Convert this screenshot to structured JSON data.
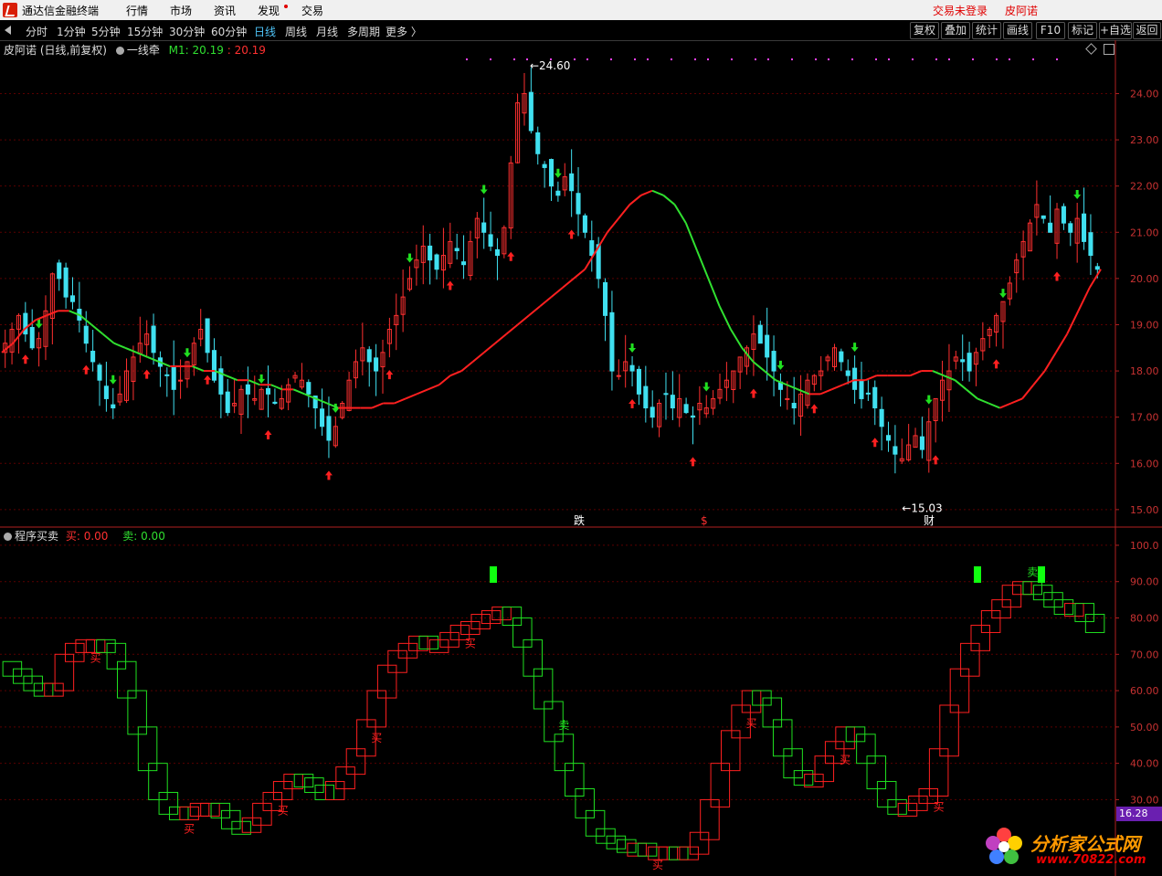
{
  "app": {
    "title": "通达信金融终端",
    "login_status": "交易未登录",
    "stock_name": "皮阿诺"
  },
  "menu": [
    "行情",
    "市场",
    "资讯",
    "发现",
    "交易"
  ],
  "periods": [
    "分时",
    "1分钟",
    "5分钟",
    "15分钟",
    "30分钟",
    "60分钟",
    "日线",
    "周线",
    "月线",
    "多周期",
    "更多 〉"
  ],
  "active_period": "日线",
  "right_buttons": [
    "复权",
    "叠加",
    "统计",
    "画线",
    "F10",
    "标记",
    "+自选",
    "返回"
  ],
  "main_panel": {
    "title": "皮阿诺 (日线,前复权)",
    "indicator": "一线牵",
    "m1_label": "M1:",
    "m1_value": "20.19",
    "m1_value2": ": 20.19",
    "high_label": "24.60",
    "low_label": "15.03",
    "markers": [
      "跌",
      "$",
      "财"
    ],
    "y_ticks": [
      "24.00",
      "23.00",
      "22.00",
      "21.00",
      "20.00",
      "19.00",
      "18.00",
      "17.00",
      "16.00",
      "15.00"
    ]
  },
  "sub_panel": {
    "title": "程序买卖",
    "buy_label": "买: 0.00",
    "sell_label": "卖: 0.00",
    "buy_text": "买",
    "sell_text": "卖",
    "y_ticks": [
      "100.0",
      "90.00",
      "80.00",
      "70.00",
      "60.00",
      "50.00",
      "40.00",
      "30.00"
    ],
    "current_value": "16.28"
  },
  "watermark": {
    "name": "分析家公式网",
    "url": "www.70822.com"
  },
  "colors": {
    "up": "#ff3030",
    "down": "#40e0f0",
    "ma_down": "#30e030",
    "ma_up": "#ff2020",
    "grid": "#5a0000"
  },
  "chart_data": {
    "type": "candlestick",
    "price_range": [
      14.8,
      24.8
    ],
    "close_series": [
      18.6,
      18.9,
      19.2,
      18.8,
      18.5,
      18.7,
      19.3,
      20.1,
      20.0,
      19.6,
      19.5,
      19.1,
      18.6,
      18.2,
      17.8,
      17.4,
      17.2,
      17.5,
      18.0,
      18.3,
      18.6,
      18.8,
      18.4,
      18.1,
      17.9,
      17.6,
      17.8,
      18.2,
      18.6,
      18.9,
      18.4,
      17.8,
      17.5,
      17.1,
      17.3,
      17.6,
      17.5,
      17.4,
      17.6,
      17.5,
      17.3,
      17.4,
      17.7,
      17.9,
      17.8,
      17.5,
      17.2,
      16.8,
      16.5,
      16.8,
      17.3,
      17.8,
      18.2,
      18.5,
      18.2,
      18.0,
      18.4,
      18.9,
      19.2,
      19.6,
      20.0,
      20.4,
      20.7,
      20.4,
      20.2,
      20.5,
      20.8,
      20.6,
      20.3,
      20.8,
      21.3,
      21.0,
      20.7,
      20.5,
      21.1,
      22.5,
      23.8,
      24.0,
      23.2,
      22.7,
      22.4,
      22.0,
      21.8,
      22.2,
      21.9,
      21.4,
      21.0,
      20.5,
      20.0,
      19.2,
      18.0,
      17.9,
      18.2,
      18.0,
      17.5,
      17.2,
      17.0,
      17.3,
      17.5,
      17.2,
      17.4,
      17.1,
      17.0,
      17.3,
      17.2,
      17.4,
      17.6,
      17.8,
      18.0,
      18.3,
      18.5,
      18.8,
      18.6,
      18.3,
      18.0,
      17.6,
      17.4,
      17.2,
      17.5,
      17.8,
      17.9,
      18.0,
      18.3,
      18.5,
      18.2,
      17.9,
      17.6,
      17.4,
      17.5,
      17.2,
      16.8,
      16.5,
      16.2,
      16.1,
      16.4,
      16.6,
      16.3,
      16.9,
      17.4,
      17.8,
      18.0,
      18.3,
      18.2,
      18.0,
      18.4,
      18.7,
      18.9,
      19.2,
      19.5,
      19.9,
      20.4,
      20.8,
      21.2,
      21.6,
      21.3,
      21.0,
      21.5,
      21.2,
      21.0,
      21.3,
      20.8,
      20.5,
      20.2
    ],
    "ma_series": [
      18.4,
      18.6,
      18.9,
      19.1,
      19.2,
      19.3,
      19.3,
      19.2,
      19.0,
      18.8,
      18.6,
      18.5,
      18.4,
      18.3,
      18.2,
      18.1,
      18.1,
      18.1,
      18.0,
      18.0,
      17.9,
      17.8,
      17.8,
      17.7,
      17.7,
      17.6,
      17.6,
      17.5,
      17.4,
      17.3,
      17.2,
      17.2,
      17.2,
      17.2,
      17.3,
      17.3,
      17.4,
      17.5,
      17.6,
      17.7,
      17.9,
      18.0,
      18.2,
      18.4,
      18.6,
      18.8,
      19.0,
      19.2,
      19.4,
      19.6,
      19.8,
      20.0,
      20.2,
      20.6,
      21.0,
      21.3,
      21.6,
      21.8,
      21.9,
      21.8,
      21.6,
      21.2,
      20.6,
      20.0,
      19.4,
      18.9,
      18.5,
      18.2,
      18.0,
      17.8,
      17.7,
      17.6,
      17.5,
      17.5,
      17.6,
      17.7,
      17.8,
      17.8,
      17.9,
      17.9,
      17.9,
      17.9,
      18.0,
      18.0,
      17.9,
      17.8,
      17.6,
      17.4,
      17.3,
      17.2,
      17.3,
      17.4,
      17.7,
      18.0,
      18.4,
      18.8,
      19.3,
      19.8,
      20.2
    ],
    "cci_series": [
      68,
      66,
      64,
      62,
      61,
      62,
      70,
      73,
      74,
      74,
      73,
      68,
      60,
      50,
      40,
      32,
      28,
      27,
      28,
      29,
      29,
      27,
      24,
      23,
      25,
      29,
      32,
      35,
      37,
      36,
      34,
      32,
      35,
      39,
      44,
      52,
      60,
      67,
      71,
      73,
      75,
      74,
      74,
      76,
      78,
      79,
      81,
      82,
      83,
      80,
      74,
      66,
      57,
      48,
      40,
      33,
      27,
      22,
      20,
      19,
      18,
      18,
      17,
      17,
      17,
      16,
      17,
      21,
      30,
      40,
      49,
      56,
      60,
      58,
      52,
      44,
      38,
      36,
      37,
      42,
      46,
      50,
      48,
      42,
      35,
      30,
      28,
      29,
      31,
      33,
      44,
      56,
      66,
      73,
      78,
      82,
      85,
      89,
      90,
      89,
      87,
      85,
      83,
      84,
      81,
      78
    ]
  }
}
